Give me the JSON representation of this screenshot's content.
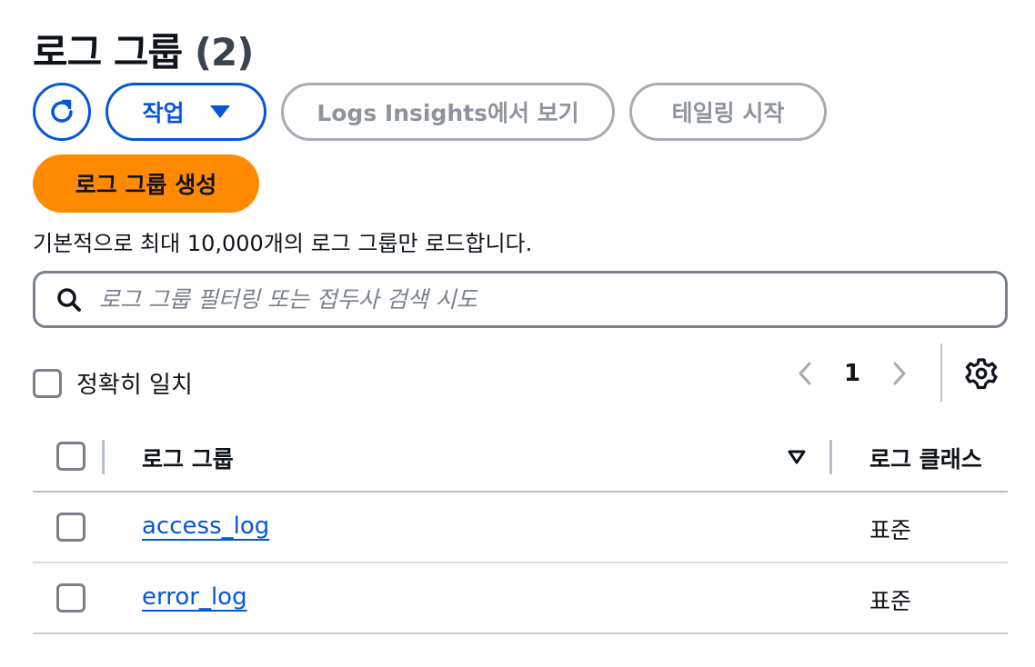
{
  "header": {
    "title": "로그 그룹",
    "count": "(2)"
  },
  "toolbar": {
    "refresh_icon": "refresh-icon",
    "actions_label": "작업",
    "insights_label": "Logs Insights에서 보기",
    "tail_label": "테일링 시작",
    "create_label": "로그 그룹 생성"
  },
  "hint": "기본적으로 최대 10,000개의 로그 그룹만 로드합니다.",
  "search": {
    "placeholder": "로그 그룹 필터링 또는 접두사 검색 시도",
    "value": ""
  },
  "exact_match": {
    "label": "정확히 일치",
    "checked": false
  },
  "pagination": {
    "current_page": "1"
  },
  "table": {
    "columns": {
      "name": "로그 그룹",
      "class": "로그 클래스"
    },
    "rows": [
      {
        "name": "access_log",
        "class": "표준"
      },
      {
        "name": "error_log",
        "class": "표준"
      }
    ]
  },
  "colors": {
    "accent": "#0657d8",
    "primary_button": "#ff8a00",
    "disabled": "#8f949c"
  }
}
